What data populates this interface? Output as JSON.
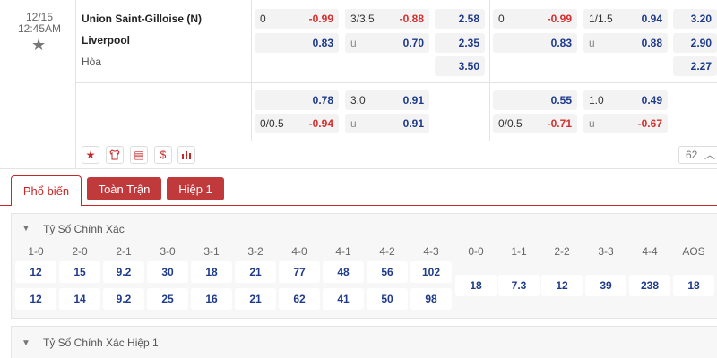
{
  "match": {
    "date": "12/15",
    "time": "12:45AM",
    "home_team": "Union Saint-Gilloise (N)",
    "away_team": "Liverpool",
    "draw_label": "Hòa"
  },
  "ft_odds": {
    "handicap_line_1": "0",
    "handicap_home_1": "-0.99",
    "handicap_away_1": "0.83",
    "ou_line_1": "3/3.5",
    "ou_over_1": "-0.88",
    "ou_under_label": "u",
    "ou_under_1": "0.70",
    "x12_home": "2.58",
    "x12_away": "2.35",
    "x12_draw": "3.50",
    "handicap_home_2": "0.78",
    "handicap_line_2": "0/0.5",
    "handicap_away_2": "-0.94",
    "ou_line_2": "3.0",
    "ou_over_2": "0.91",
    "ou_under_2": "0.91"
  },
  "ht_odds": {
    "handicap_line_1": "0",
    "handicap_home_1": "-0.99",
    "handicap_away_1": "0.83",
    "ou_line_1": "1/1.5",
    "ou_over_1": "0.94",
    "ou_under_label": "u",
    "ou_under_1": "0.88",
    "x12_home": "3.20",
    "x12_away": "2.90",
    "x12_draw": "2.27",
    "handicap_home_2": "0.55",
    "handicap_line_2": "0/0.5",
    "handicap_away_2": "-0.71",
    "ou_line_2": "1.0",
    "ou_over_2": "0.49",
    "ou_under_2": "-0.67"
  },
  "actions": {
    "icons": [
      "star-icon",
      "jersey-icon",
      "stats-icon",
      "dollar-icon",
      "bar-chart-icon"
    ],
    "icon_glyphs": [
      "★",
      "👕",
      "▤",
      "$",
      "ılı"
    ],
    "more_count": "62"
  },
  "tabs": [
    "Phổ biến",
    "Toàn Trận",
    "Hiệp 1"
  ],
  "correct_score": {
    "title": "Tỷ Số Chính Xác",
    "headers": [
      "1-0",
      "2-0",
      "2-1",
      "3-0",
      "3-1",
      "3-2",
      "4-0",
      "4-1",
      "4-2",
      "4-3",
      "0-0",
      "1-1",
      "2-2",
      "3-3",
      "4-4",
      "AOS"
    ],
    "home_win_odds": [
      "12",
      "15",
      "9.2",
      "30",
      "18",
      "21",
      "77",
      "48",
      "56",
      "102"
    ],
    "away_win_odds": [
      "12",
      "14",
      "9.2",
      "25",
      "16",
      "21",
      "62",
      "41",
      "50",
      "98"
    ],
    "draw_odds": [
      "18",
      "7.3",
      "12",
      "39",
      "238",
      "18"
    ]
  },
  "correct_score_ht": {
    "title": "Tỷ Số Chính Xác Hiệp 1"
  }
}
